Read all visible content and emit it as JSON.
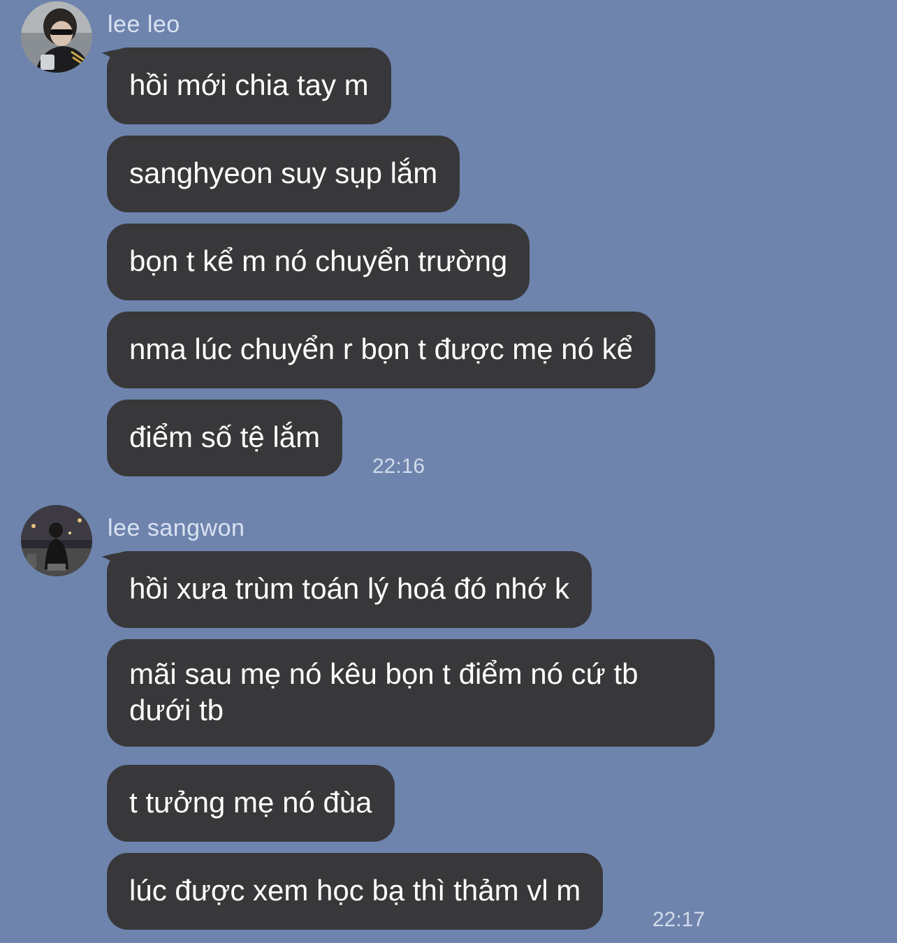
{
  "conversation": [
    {
      "sender": "lee leo",
      "avatar_icon": "profile-photo-sunglasses",
      "messages": [
        "hồi mới chia tay m",
        "sanghyeon suy sụp lắm",
        "bọn t kể m nó chuyển trường",
        "nma lúc chuyển r bọn t được mẹ nó kể",
        "điểm số tệ lắm"
      ],
      "time": "22:16"
    },
    {
      "sender": "lee sangwon",
      "avatar_icon": "profile-photo-night-city",
      "messages": [
        "hồi xưa trùm toán lý hoá đó nhớ k",
        "mãi sau mẹ nó kêu bọn t điểm nó cứ tb dưới tb",
        "t tưởng mẹ nó đùa",
        "lúc được xem học bạ thì thảm vl m"
      ],
      "time": "22:17"
    }
  ],
  "colors": {
    "background": "#6e84ad",
    "bubble": "#38383b",
    "bubble_text": "#ffffff",
    "sender_name": "#d9e2f2",
    "timestamp": "#d3dbea"
  }
}
